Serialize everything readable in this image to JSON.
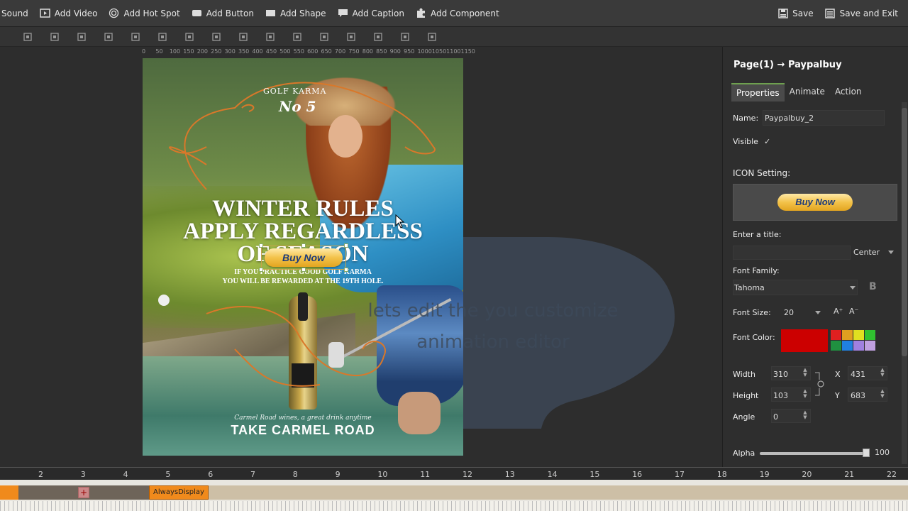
{
  "topbar": {
    "items": [
      {
        "label": "Sound",
        "icon": "sound-icon"
      },
      {
        "label": "Add Video",
        "icon": "video-icon"
      },
      {
        "label": "Add Hot Spot",
        "icon": "hotspot-icon"
      },
      {
        "label": "Add Button",
        "icon": "button-icon"
      },
      {
        "label": "Add Shape",
        "icon": "shape-icon"
      },
      {
        "label": "Add Caption",
        "icon": "caption-icon"
      },
      {
        "label": "Add Component",
        "icon": "puzzle-icon"
      }
    ],
    "save": "Save",
    "save_exit": "Save and Exit"
  },
  "toolbar_icons": [
    "align-left-icon",
    "copy-icon",
    "bring-front-icon",
    "send-back-icon",
    "bring-forward-icon",
    "distribute-h-icon",
    "distribute-v-icon",
    "align-center-icon",
    "grid-icon",
    "align-top-icon",
    "align-bottom-icon",
    "duplicate-icon",
    "paste-icon",
    "delete-icon",
    "undo-icon",
    "redo-icon"
  ],
  "ruler": [
    "0",
    "50",
    "100",
    "150",
    "200",
    "250",
    "300",
    "350",
    "400",
    "450",
    "500",
    "550",
    "600",
    "650",
    "700",
    "750",
    "800",
    "850",
    "900",
    "950",
    "1000",
    "1050",
    "1100",
    "1150"
  ],
  "page": {
    "golf_karma": "GOLF KARMA",
    "no5": "No 5",
    "headline_1": "WINTER RULES",
    "headline_2": "APPLY REGARDLESS",
    "headline_3": "OF SEASON",
    "sub_1": "IF YOU PRACTICE GOOD GOLF KARMA",
    "sub_2": "YOU WILL BE REWARDED AT THE 19TH HOLE.",
    "buy_now": "Buy Now",
    "tagline_small": "Carmel Road wines, a great drink anytime",
    "take": "TAKE CARMEL ROAD"
  },
  "bubble_text_1": "lets edit the you customize",
  "bubble_text_2": "animation editor",
  "panel": {
    "breadcrumb": "Page(1) → Paypalbuy",
    "tabs": [
      "Properties",
      "Animate",
      "Action"
    ],
    "name_label": "Name:",
    "name_value": "Paypalbuy_2",
    "visible_label": "Visible",
    "visible_check": "✓",
    "icon_setting": "ICON Setting:",
    "icon_button": "Buy Now",
    "title_label": "Enter a title:",
    "align_value": "Center",
    "font_family_label": "Font Family:",
    "font_family_value": "Tahoma",
    "bold_label": "B",
    "font_size_label": "Font Size:",
    "font_size_value": "20",
    "font_color_label": "Font Color:",
    "font_color_value": "#cc0000",
    "swatches": [
      "#e02020",
      "#e0a020",
      "#e0e020",
      "#30c030",
      "#209040",
      "#2080e0",
      "#a080e0",
      "#c0a0e0"
    ],
    "width_label": "Width",
    "width_value": "310",
    "x_label": "X",
    "x_value": "431",
    "height_label": "Height",
    "height_value": "103",
    "y_label": "Y",
    "y_value": "683",
    "angle_label": "Angle",
    "angle_value": "0",
    "alpha_label": "Alpha",
    "alpha_value": "100"
  },
  "timeline": {
    "numbers": [
      "2",
      "3",
      "4",
      "5",
      "6",
      "7",
      "8",
      "9",
      "10",
      "11",
      "12",
      "13",
      "14",
      "15",
      "16",
      "17",
      "18",
      "19",
      "20",
      "21",
      "22"
    ],
    "plus": "+",
    "always_display": "AlwaysDisplay"
  }
}
